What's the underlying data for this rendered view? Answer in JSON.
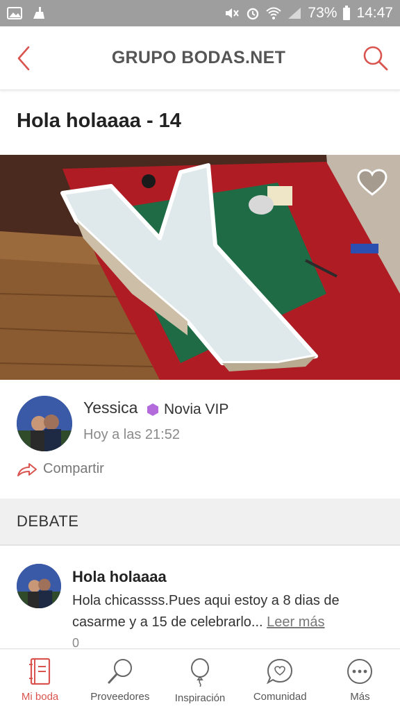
{
  "status_bar": {
    "battery": "73%",
    "time": "14:47"
  },
  "header": {
    "title": "GRUPO BODAS.NET"
  },
  "post": {
    "title": "Hola holaaaa - 14",
    "author": {
      "name": "Yessica",
      "badge": "Novia VIP",
      "time": "Hoy a las 21:52"
    },
    "share_label": "Compartir"
  },
  "debate": {
    "section_label": "DEBATE",
    "comment": {
      "title": "Hola holaaaa",
      "text": "Hola chicassss.Pues aqui estoy a 8 dias de casarme y a 15 de celebrarlo...",
      "read_more": "Leer más",
      "count": "0"
    }
  },
  "bottom_nav": [
    {
      "label": "Mi boda",
      "icon": "notebook-icon",
      "active": true
    },
    {
      "label": "Proveedores",
      "icon": "magnifier-icon",
      "active": false
    },
    {
      "label": "Inspiración",
      "icon": "balloon-icon",
      "active": false
    },
    {
      "label": "Comunidad",
      "icon": "chat-heart-icon",
      "active": false
    },
    {
      "label": "Más",
      "icon": "more-icon",
      "active": false
    }
  ],
  "colors": {
    "accent": "#d9534f",
    "status_bar": "#9e9e9e",
    "vip_badge": "#b36bdc"
  }
}
